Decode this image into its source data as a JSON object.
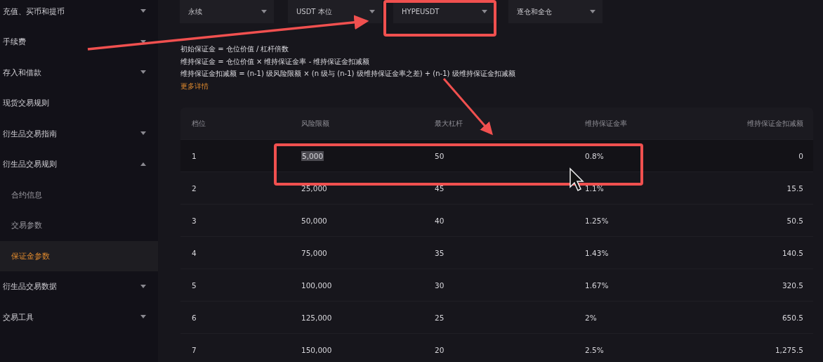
{
  "sidebar": {
    "items": [
      {
        "label": "充值、买币和提币",
        "kind": "group",
        "expanded": false
      },
      {
        "label": "手续费",
        "kind": "group",
        "expanded": false
      },
      {
        "label": "存入和借款",
        "kind": "group",
        "expanded": false
      },
      {
        "label": "现货交易规则",
        "kind": "link"
      },
      {
        "label": "衍生品交易指南",
        "kind": "group",
        "expanded": false
      },
      {
        "label": "衍生品交易规则",
        "kind": "group",
        "expanded": true,
        "children": [
          {
            "label": "合约信息",
            "selected": false
          },
          {
            "label": "交易参数",
            "selected": false
          },
          {
            "label": "保证金参数",
            "selected": true
          }
        ]
      },
      {
        "label": "衍生品交易数据",
        "kind": "group",
        "expanded": false
      },
      {
        "label": "交易工具",
        "kind": "group",
        "expanded": false
      }
    ]
  },
  "filters": [
    {
      "value": "永续"
    },
    {
      "value": "USDT 本位"
    },
    {
      "value": "HYPEUSDT"
    },
    {
      "value": "逐仓和全仓"
    }
  ],
  "formulas": [
    "初始保证金 = 仓位价值 / 杠杆倍数",
    "维持保证金 = 仓位价值 × 维持保证金率 - 维持保证金扣减额",
    "维持保证金扣减额 = (n-1) 级风险限额 × (n 级与 (n-1) 级维持保证金率之差) + (n-1) 级维持保证金扣减额"
  ],
  "more_link": "更多详情",
  "table": {
    "columns": [
      "档位",
      "风险限额",
      "最大杠杆",
      "维持保证金率",
      "维持保证金扣减额"
    ],
    "rows": [
      {
        "cells": [
          "1",
          "5,000",
          "50",
          "0.8%",
          "0"
        ],
        "risk_limit_highlighted": true
      },
      {
        "cells": [
          "2",
          "25,000",
          "45",
          "1.1%",
          "15.5"
        ]
      },
      {
        "cells": [
          "3",
          "50,000",
          "40",
          "1.25%",
          "50.5"
        ]
      },
      {
        "cells": [
          "4",
          "75,000",
          "35",
          "1.43%",
          "140.5"
        ]
      },
      {
        "cells": [
          "5",
          "100,000",
          "30",
          "1.67%",
          "320.5"
        ]
      },
      {
        "cells": [
          "6",
          "125,000",
          "25",
          "2%",
          "650.5"
        ]
      },
      {
        "cells": [
          "7",
          "150,000",
          "20",
          "2.5%",
          "1,275.5"
        ]
      }
    ]
  }
}
